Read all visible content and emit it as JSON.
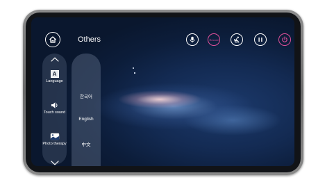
{
  "header": {
    "title": "Others"
  },
  "toolbar": {
    "record_label": "Record"
  },
  "sidebar": {
    "items": [
      {
        "label": "Language",
        "icon_letter": "A",
        "icon": "language-icon"
      },
      {
        "label": "Touch sound",
        "icon": "speaker-icon"
      },
      {
        "label": "Photo therapy",
        "icon": "photo-icon"
      }
    ]
  },
  "language_panel": {
    "options": [
      "한국어",
      "English",
      "中文"
    ]
  },
  "colors": {
    "accent_pink": "#e0509a",
    "sidebar_bg": "#3c4b64",
    "screen_bg": "#132a52"
  }
}
